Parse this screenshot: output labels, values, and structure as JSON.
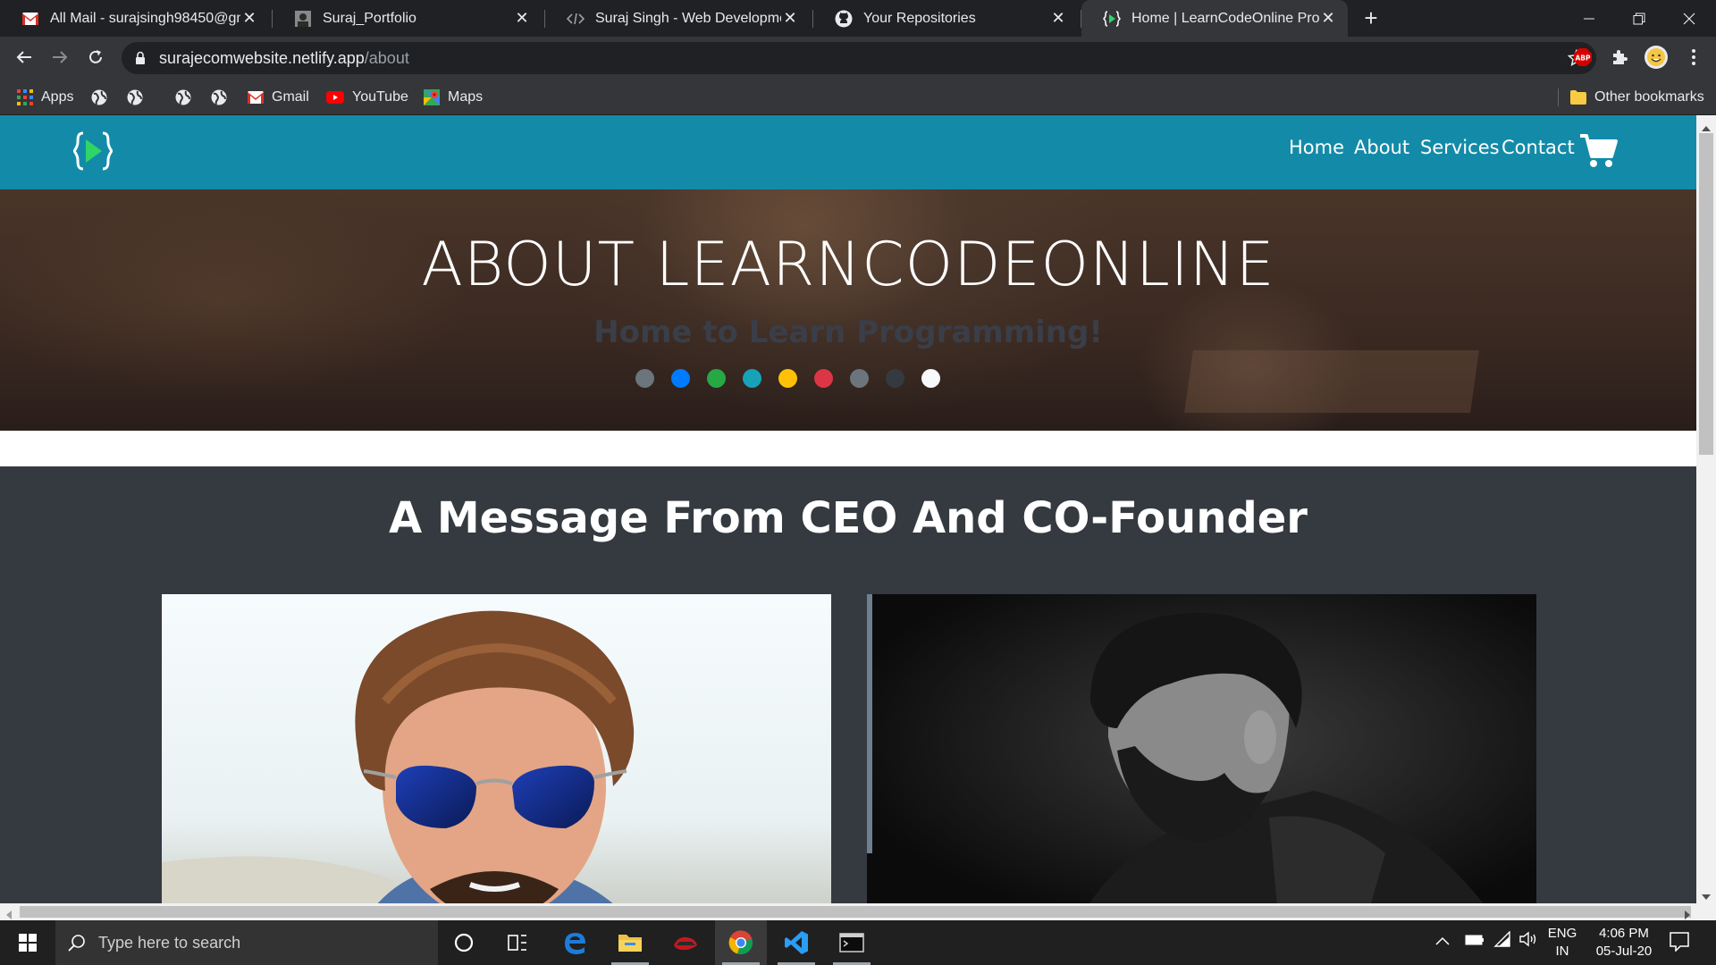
{
  "browser": {
    "tabs": [
      {
        "title": "All Mail - surajsingh98450@gmail.com",
        "icon": "gmail-icon",
        "active": false
      },
      {
        "title": "Suraj_Portfolio",
        "icon": "portrait-icon",
        "active": false
      },
      {
        "title": "Suraj Singh - Web Development",
        "icon": "code-icon",
        "active": false
      },
      {
        "title": "Your Repositories",
        "icon": "github-icon",
        "active": false
      },
      {
        "title": "Home | LearnCodeOnline Project",
        "icon": "play-brackets-icon",
        "active": true
      }
    ],
    "new_tab_label": "+",
    "url_domain": "surajecomwebsite.netlify.app",
    "url_path": "/about",
    "extensions": [
      "abp-icon",
      "puzzle-icon",
      "profile-avatar"
    ],
    "bookmarks": [
      {
        "label": "Apps",
        "icon": "apps-grid-icon"
      },
      {
        "label": "",
        "icon": "globe-icon"
      },
      {
        "label": "",
        "icon": "globe-icon"
      },
      {
        "label": "",
        "icon": "globe-icon"
      },
      {
        "label": "",
        "icon": "globe-icon"
      },
      {
        "label": "Gmail",
        "icon": "gmail-icon"
      },
      {
        "label": "YouTube",
        "icon": "youtube-icon"
      },
      {
        "label": "Maps",
        "icon": "maps-icon"
      }
    ],
    "other_bookmarks": "Other bookmarks"
  },
  "site": {
    "nav": {
      "links": [
        "Home",
        "About",
        "Services",
        "Contact"
      ],
      "cart_icon": "cart-icon"
    },
    "hero": {
      "title": "ABOUT LEARNCODEONLINE",
      "subtitle": "Home to Learn Programming!",
      "dot_colors": [
        "#6c757d",
        "#007bff",
        "#28a745",
        "#17a2b8",
        "#ffc107",
        "#dc3545",
        "#6c757d",
        "#343a40",
        "#f8f9fa"
      ]
    },
    "section": {
      "title": "A Message From CEO And CO-Founder"
    }
  },
  "taskbar": {
    "search_placeholder": "Type here to search",
    "language": "ENG",
    "region": "IN",
    "time": "4:06 PM",
    "date": "05-Jul-20"
  },
  "colors": {
    "site_nav": "#138ba8",
    "dark_section": "#343a40"
  }
}
